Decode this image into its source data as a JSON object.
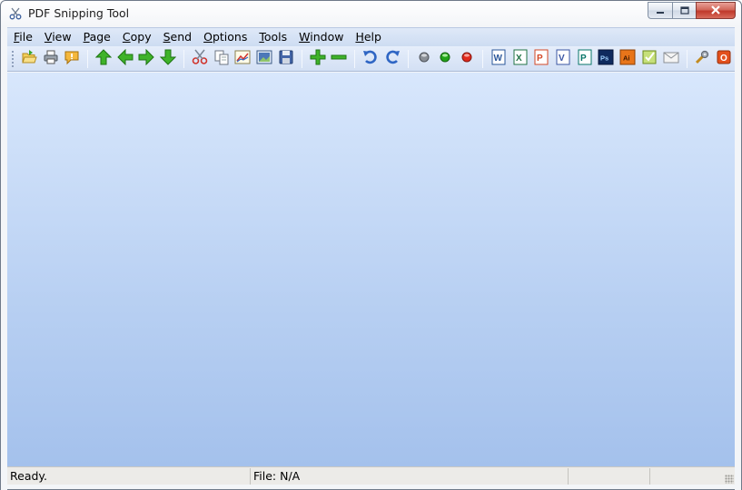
{
  "window": {
    "title": "PDF Snipping Tool",
    "controls": {
      "minimize": "minimize",
      "maximize": "maximize",
      "close": "close"
    }
  },
  "menu": [
    {
      "id": "file",
      "accel": "F",
      "rest": "ile"
    },
    {
      "id": "view",
      "accel": "V",
      "rest": "iew"
    },
    {
      "id": "page",
      "accel": "P",
      "rest": "age"
    },
    {
      "id": "copy",
      "accel": "C",
      "rest": "opy"
    },
    {
      "id": "send",
      "accel": "S",
      "rest": "end"
    },
    {
      "id": "options",
      "accel": "O",
      "rest": "ptions"
    },
    {
      "id": "tools",
      "accel": "T",
      "rest": "ools"
    },
    {
      "id": "window",
      "accel": "W",
      "rest": "indow"
    },
    {
      "id": "help",
      "accel": "H",
      "rest": "elp"
    }
  ],
  "toolbar": {
    "icons": [
      "open-icon",
      "print-icon",
      "info-icon",
      "arrow-up-icon",
      "arrow-left-icon",
      "arrow-right-icon",
      "arrow-down-icon",
      "cut-icon",
      "copy-icon",
      "chart-icon",
      "image-icon",
      "save-icon",
      "zoom-in-icon",
      "zoom-out-icon",
      "undo-icon",
      "redo-icon",
      "gray-dot-icon",
      "green-dot-icon",
      "red-dot-icon",
      "word-icon",
      "excel-icon",
      "powerpoint-icon",
      "visio-icon",
      "publisher-icon",
      "photoshop-icon",
      "illustrator-icon",
      "notepad-icon",
      "mail-icon",
      "settings-icon",
      "office-icon"
    ],
    "app_letters": {
      "word": "W",
      "excel": "X",
      "powerpoint": "P",
      "visio": "V",
      "publisher": "P",
      "photoshop": "Ps",
      "illustrator": "Ai",
      "office": "O"
    }
  },
  "colors": {
    "accent_green": "#2e9a1e",
    "accent_blue": "#2f66c4",
    "close_red": "#c0392b",
    "client_top": "#d8e7fc",
    "client_bottom": "#a4c1ec"
  },
  "status": {
    "ready": "Ready.",
    "file": "File: N/A",
    "pane3": "",
    "pane4": ""
  }
}
